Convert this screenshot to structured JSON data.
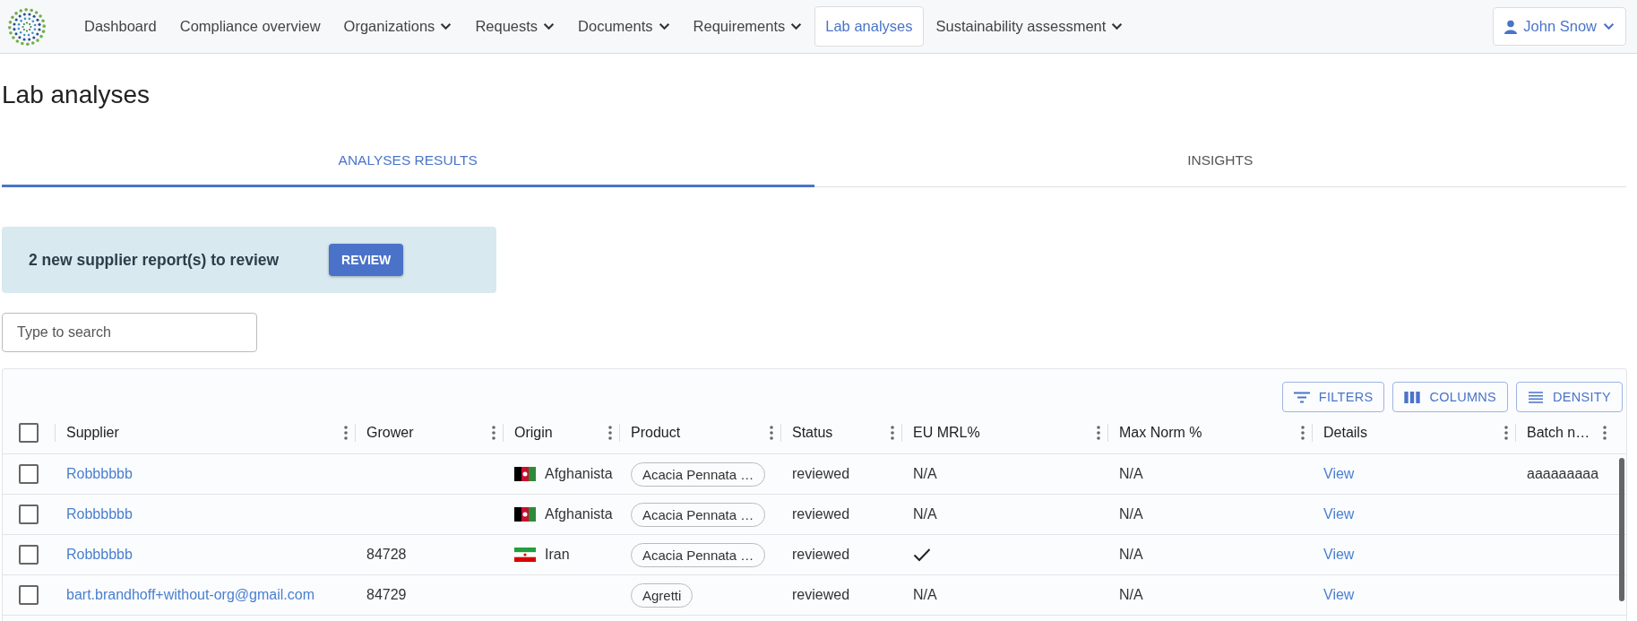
{
  "nav": {
    "items": [
      {
        "label": "Dashboard",
        "dropdown": false,
        "selected": false
      },
      {
        "label": "Compliance overview",
        "dropdown": false,
        "selected": false
      },
      {
        "label": "Organizations",
        "dropdown": true,
        "selected": false
      },
      {
        "label": "Requests",
        "dropdown": true,
        "selected": false
      },
      {
        "label": "Documents",
        "dropdown": true,
        "selected": false
      },
      {
        "label": "Requirements",
        "dropdown": true,
        "selected": false
      },
      {
        "label": "Lab analyses",
        "dropdown": false,
        "selected": true
      },
      {
        "label": "Sustainability assessment",
        "dropdown": true,
        "selected": false
      }
    ],
    "user": {
      "name": "John Snow"
    }
  },
  "page_title": "Lab analyses",
  "tabs": [
    {
      "label": "ANALYSES RESULTS",
      "selected": true
    },
    {
      "label": "INSIGHTS",
      "selected": false
    }
  ],
  "banner": {
    "text": "2 new supplier report(s) to review",
    "button": "REVIEW"
  },
  "search": {
    "placeholder": "Type to search"
  },
  "table": {
    "toolbar": [
      {
        "kind": "filters",
        "label": "FILTERS"
      },
      {
        "kind": "columns",
        "label": "COLUMNS"
      },
      {
        "kind": "density",
        "label": "DENSITY"
      }
    ],
    "all_selected": false,
    "columns": [
      "Supplier",
      "Grower",
      "Origin",
      "Product",
      "Status",
      "EU MRL%",
      "Max Norm %",
      "Details",
      "Batch n…"
    ],
    "rows": [
      {
        "selected": false,
        "supplier": "Robbbbbb",
        "origin": {
          "name": "Afghanista",
          "kind": "afghanistan"
        },
        "product": "Acacia Pennata …",
        "status": "reviewed",
        "eu_mrl": {
          "kind": "text",
          "text": "N/A"
        },
        "max_norm": "N/A",
        "details": "View",
        "batch": "aaaaaaaaa"
      },
      {
        "selected": false,
        "supplier": "Robbbbbb",
        "origin": {
          "name": "Afghanista",
          "kind": "afghanistan"
        },
        "product": "Acacia Pennata …",
        "status": "reviewed",
        "eu_mrl": {
          "kind": "text",
          "text": "N/A"
        },
        "max_norm": "N/A",
        "details": "View"
      },
      {
        "selected": false,
        "supplier": "Robbbbbb",
        "grower": "84728",
        "origin": {
          "name": "Iran",
          "kind": "iran"
        },
        "product": "Acacia Pennata …",
        "status": "reviewed",
        "eu_mrl": {
          "kind": "check"
        },
        "max_norm": "N/A",
        "details": "View"
      },
      {
        "selected": false,
        "supplier": "bart.brandhoff+without-org@gmail.com",
        "grower": "84729",
        "product": "Agretti",
        "status": "reviewed",
        "eu_mrl": {
          "kind": "text",
          "text": "N/A"
        },
        "max_norm": "N/A",
        "details": "View"
      }
    ]
  }
}
